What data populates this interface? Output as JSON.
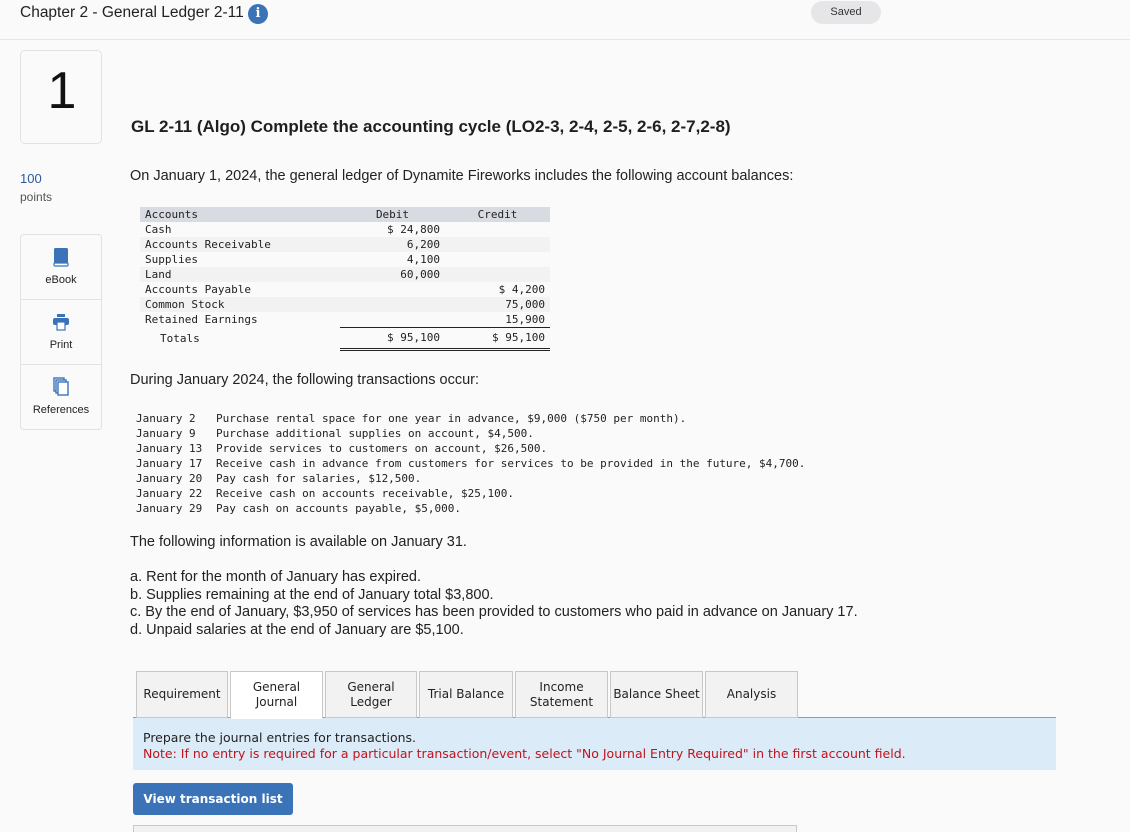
{
  "header": {
    "chapter_title": "Chapter 2 - General Ledger 2-11",
    "info_icon": "info-icon",
    "saved_status": "Saved"
  },
  "question": {
    "number": "1",
    "points_value": "100",
    "points_label": "points",
    "title": "GL 2-11 (Algo) Complete the accounting cycle (LO2-3, 2-4, 2-5, 2-6, 2-7,2-8)",
    "intro": "On January 1, 2024, the general ledger of Dynamite Fireworks includes the following account balances:"
  },
  "tools": [
    {
      "label": "eBook",
      "icon": "book-icon"
    },
    {
      "label": "Print",
      "icon": "printer-icon"
    },
    {
      "label": "References",
      "icon": "copy-pages-icon"
    }
  ],
  "balances": {
    "headers": [
      "Accounts",
      "Debit",
      "Credit"
    ],
    "rows": [
      {
        "account": "Cash",
        "debit": "$ 24,800",
        "credit": ""
      },
      {
        "account": "Accounts Receivable",
        "debit": "6,200",
        "credit": ""
      },
      {
        "account": "Supplies",
        "debit": "4,100",
        "credit": ""
      },
      {
        "account": "Land",
        "debit": "60,000",
        "credit": ""
      },
      {
        "account": "Accounts Payable",
        "debit": "",
        "credit": "$ 4,200"
      },
      {
        "account": "Common Stock",
        "debit": "",
        "credit": "75,000"
      },
      {
        "account": "Retained Earnings",
        "debit": "",
        "credit": "15,900"
      }
    ],
    "totals": {
      "label": "Totals",
      "debit": "$ 95,100",
      "credit": "$ 95,100"
    }
  },
  "transactions": {
    "intro": "During January 2024, the following transactions occur:",
    "items": [
      {
        "date": "January 2",
        "text": "Purchase rental space for one year in advance, $9,000 ($750 per month)."
      },
      {
        "date": "January 9",
        "text": "Purchase additional supplies on account, $4,500."
      },
      {
        "date": "January 13",
        "text": "Provide services to customers on account, $26,500."
      },
      {
        "date": "January 17",
        "text": "Receive cash in advance from customers for services to be provided in the future, $4,700."
      },
      {
        "date": "January 20",
        "text": "Pay cash for salaries, $12,500."
      },
      {
        "date": "January 22",
        "text": "Receive cash on accounts receivable, $25,100."
      },
      {
        "date": "January 29",
        "text": "Pay cash on accounts payable, $5,000."
      }
    ]
  },
  "adjustments": {
    "intro": "The following information is available on January 31.",
    "items": [
      "a. Rent for the month of January has expired.",
      "b. Supplies remaining at the end of January total $3,800.",
      "c. By the end of January, $3,950 of services has been provided to customers who paid in advance on January 17.",
      "d. Unpaid salaries at the end of January are $5,100."
    ]
  },
  "tabs": {
    "active_index": 1,
    "items": [
      {
        "label": "Requirement"
      },
      {
        "label": "General\nJournal"
      },
      {
        "label": "General\nLedger"
      },
      {
        "label": "Trial Balance"
      },
      {
        "label": "Income\nStatement"
      },
      {
        "label": "Balance Sheet"
      },
      {
        "label": "Analysis"
      }
    ]
  },
  "instructions": {
    "line1": "Prepare the journal entries for transactions.",
    "note": "Note: If no entry is required for a particular transaction/event, select \"No Journal Entry Required\" in the first account field."
  },
  "actions": {
    "view_transaction_list": "View transaction list"
  },
  "colors": {
    "accent": "#3a73b8",
    "note_red": "#c0131c",
    "instruction_bg": "#dcebf8"
  }
}
